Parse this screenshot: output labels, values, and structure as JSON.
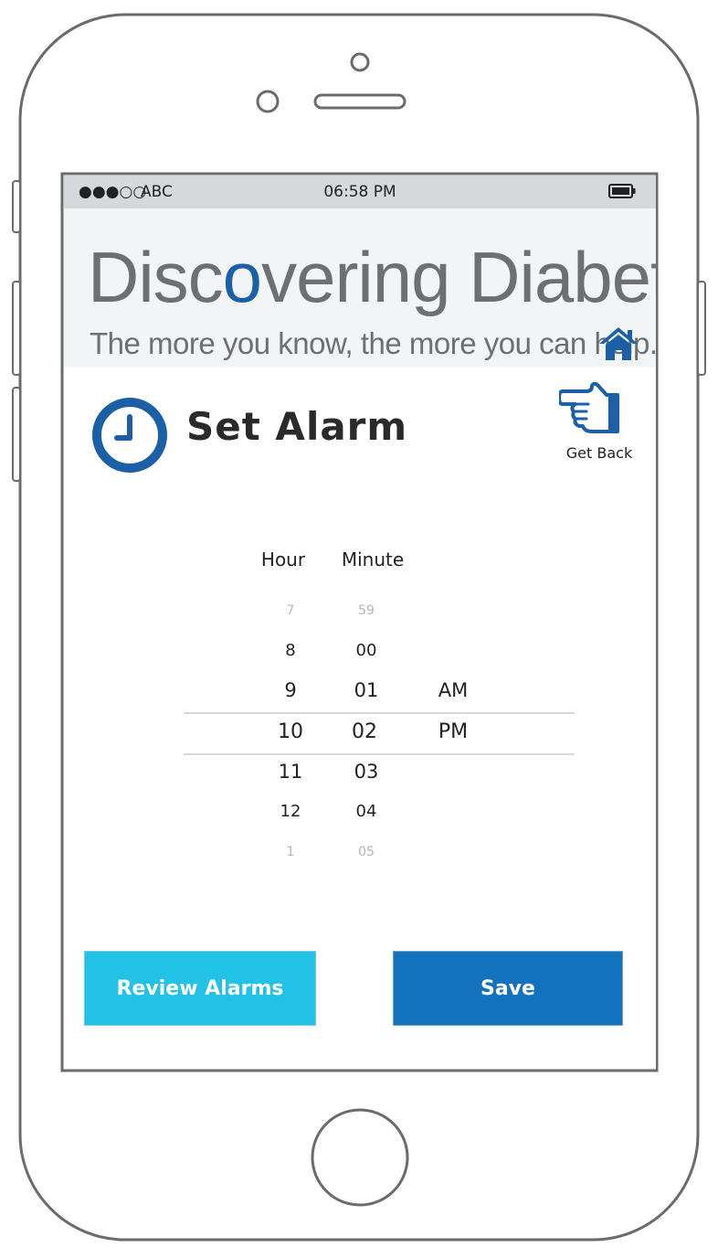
{
  "status_bar": {
    "signal": "●●●○○",
    "carrier": "ABC",
    "time": "06:58 PM",
    "battery_icon": "battery-icon"
  },
  "header": {
    "title_prefix": "Disc",
    "title_accent": "o",
    "title_suffix": "vering Diabetes",
    "tagline": "The more you know, the more you can help.",
    "home_icon": "home-icon"
  },
  "page": {
    "title": "Set Alarm",
    "title_icon": "clock-icon",
    "back_icon": "pointing-hand-icon",
    "back_label": "Get Back"
  },
  "picker": {
    "hour_label": "Hour",
    "minute_label": "Minute",
    "hours": [
      "7",
      "8",
      "9",
      "10",
      "11",
      "12",
      "1"
    ],
    "minutes": [
      "59",
      "00",
      "01",
      "02",
      "03",
      "04",
      "05"
    ],
    "periods": [
      "AM",
      "PM"
    ],
    "selected": {
      "hour": "10",
      "minute": "02",
      "period": "PM"
    }
  },
  "buttons": {
    "review_label": "Review Alarms",
    "save_label": "Save"
  },
  "colors": {
    "accent_blue": "#1b5fa7",
    "review_button": "#22c1e6",
    "save_button": "#1272bd",
    "header_bg": "#f1f5f6",
    "status_bg": "#d5d9dc"
  }
}
